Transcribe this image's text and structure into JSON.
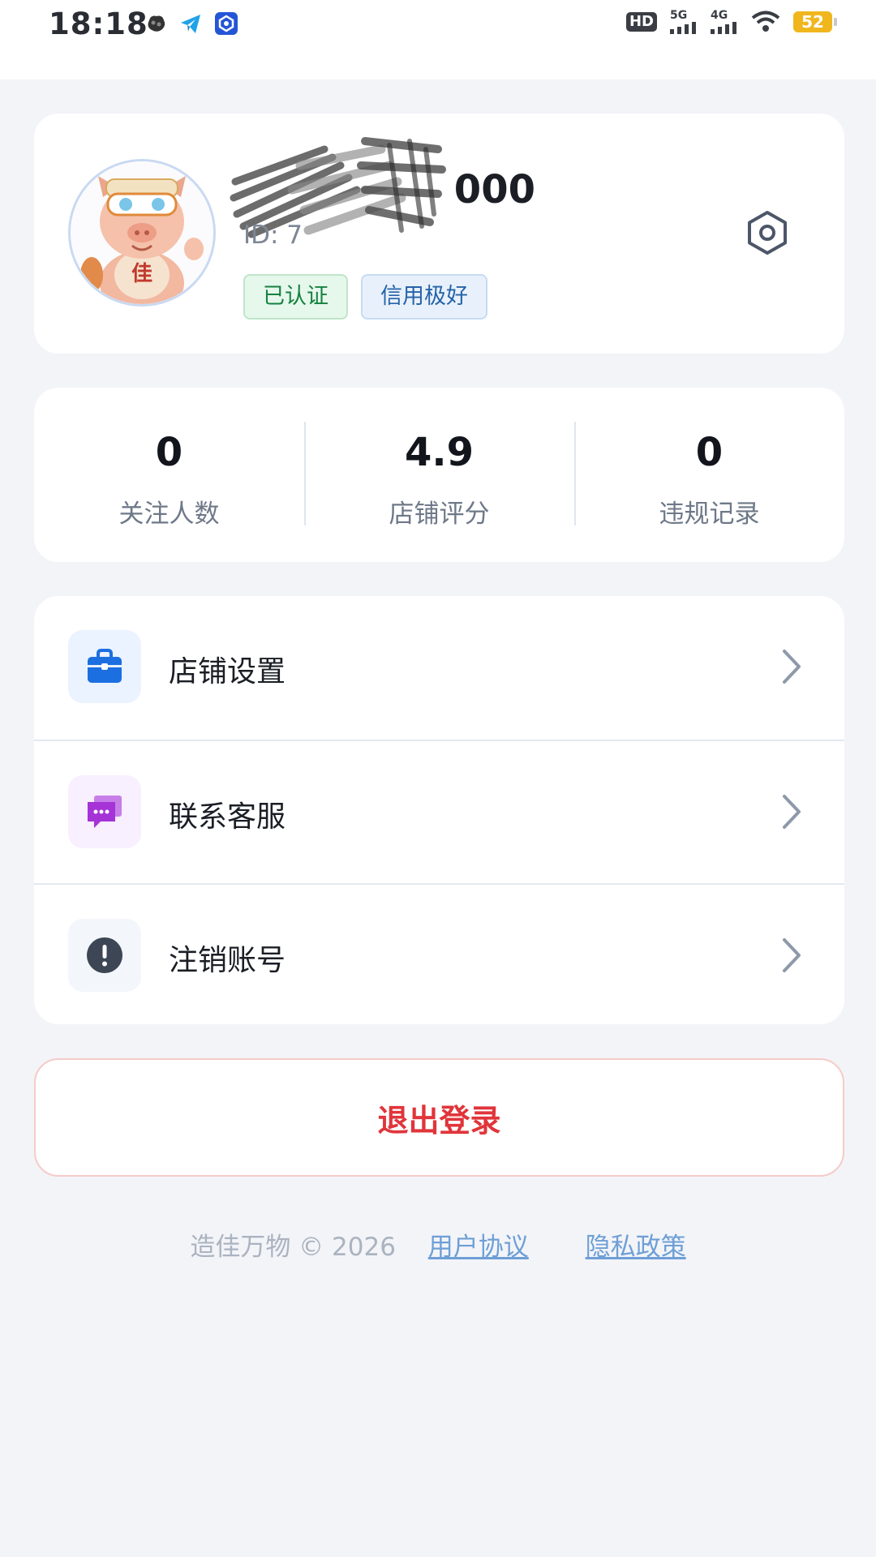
{
  "status_bar": {
    "time": "18:18",
    "hd_label": "HD",
    "sig1_label": "5G",
    "sig2_label": "4G",
    "battery": "52"
  },
  "profile": {
    "username_visible": "000",
    "id_text": "ID: 7",
    "tags": [
      "已认证",
      "信用极好"
    ],
    "avatar_badge": "佳"
  },
  "stats": [
    {
      "value": "0",
      "label": "关注人数"
    },
    {
      "value": "4.9",
      "label": "店铺评分"
    },
    {
      "value": "0",
      "label": "违规记录"
    }
  ],
  "menu": [
    {
      "label": "店铺设置",
      "icon": "shop-bag-icon",
      "color": "#1c6fe0",
      "bg": "#eaf3ff"
    },
    {
      "label": "联系客服",
      "icon": "chat-bubble-icon",
      "color": "#a533d6",
      "bg": "#f8efff"
    },
    {
      "label": "注销账号",
      "icon": "alert-circle-icon",
      "color": "#3c4654",
      "bg": "#f3f6fa"
    }
  ],
  "logout_label": "退出登录",
  "footer": {
    "copyright": "造佳万物 © 2026",
    "agreement": "用户协议",
    "privacy": "隐私政策"
  }
}
